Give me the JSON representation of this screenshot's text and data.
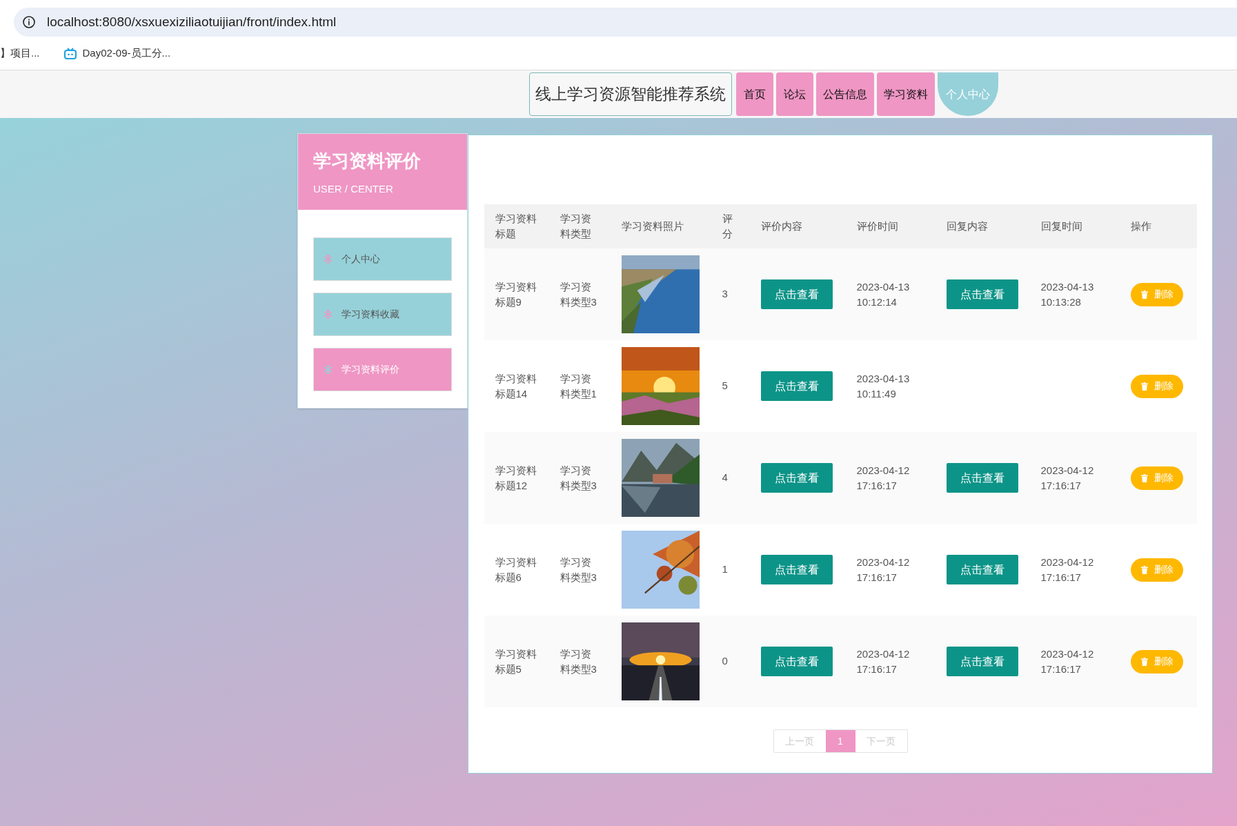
{
  "browser": {
    "url": "localhost:8080/xsxuexiziliaotuijian/front/index.html",
    "bookmarks": [
      "】项目...",
      "Day02-09-员工分..."
    ]
  },
  "nav": {
    "title": "线上学习资源智能推荐系统",
    "items": [
      {
        "label": "首页",
        "selected": false
      },
      {
        "label": "论坛",
        "selected": false
      },
      {
        "label": "公告信息",
        "selected": false
      },
      {
        "label": "学习资料",
        "selected": false
      },
      {
        "label": "个人中心",
        "selected": true
      }
    ]
  },
  "sidebar": {
    "title": "学习资料评价",
    "subtitle": "USER / CENTER",
    "items": [
      {
        "label": "个人中心",
        "selected": false
      },
      {
        "label": "学习资料收藏",
        "selected": false
      },
      {
        "label": "学习资料评价",
        "selected": true
      }
    ]
  },
  "table": {
    "columns": [
      "学习资料标题",
      "学习资料类型",
      "学习资料照片",
      "评分",
      "评价内容",
      "评价时间",
      "回复内容",
      "回复时间",
      "操作"
    ],
    "rows": [
      {
        "title": "学习资料标题9",
        "type": "学习资料类型3",
        "score": "3",
        "review": "点击查看",
        "review_time": "2023-04-13 10:12:14",
        "reply": "点击查看",
        "reply_time": "2023-04-13 10:13:28",
        "action": "删除"
      },
      {
        "title": "学习资料标题14",
        "type": "学习资料类型1",
        "score": "5",
        "review": "点击查看",
        "review_time": "2023-04-13 10:11:49",
        "action": "删除"
      },
      {
        "title": "学习资料标题12",
        "type": "学习资料类型3",
        "score": "4",
        "review": "点击查看",
        "review_time": "2023-04-12 17:16:17",
        "reply": "点击查看",
        "reply_time": "2023-04-12 17:16:17",
        "action": "删除"
      },
      {
        "title": "学习资料标题6",
        "type": "学习资料类型3",
        "score": "1",
        "review": "点击查看",
        "review_time": "2023-04-12 17:16:17",
        "reply": "点击查看",
        "reply_time": "2023-04-12 17:16:17",
        "action": "删除"
      },
      {
        "title": "学习资料标题5",
        "type": "学习资料类型3",
        "score": "0",
        "review": "点击查看",
        "review_time": "2023-04-12 17:16:17",
        "reply": "点击查看",
        "reply_time": "2023-04-12 17:16:17",
        "action": "删除"
      }
    ]
  },
  "pagination": {
    "prev": "上一页",
    "pages": [
      {
        "label": "1",
        "selected": true
      }
    ],
    "next": "下一页"
  }
}
